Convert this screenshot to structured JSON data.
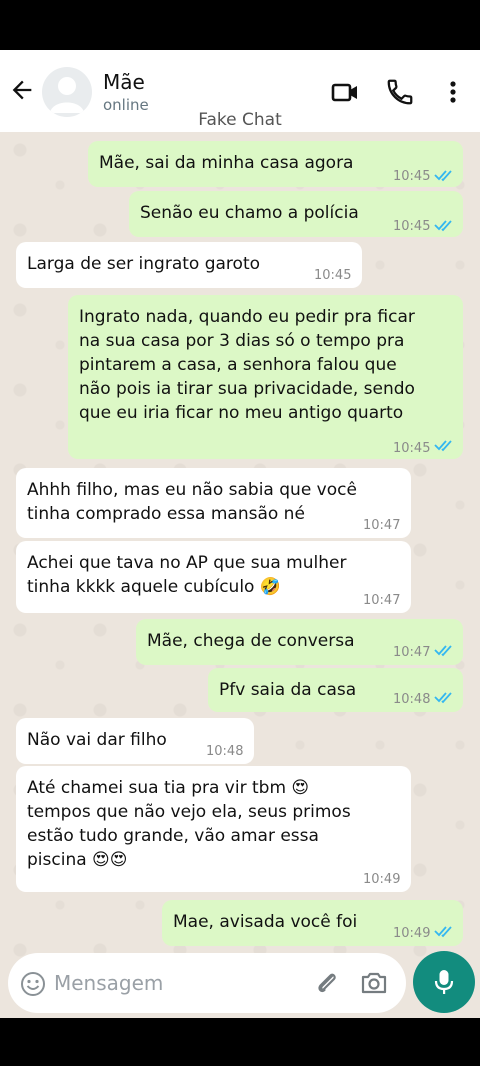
{
  "header": {
    "contact_name": "Mãe",
    "contact_status": "online",
    "watermark": "Fake Chat"
  },
  "messages": [
    {
      "direction": "out",
      "lines": "Mãe, sai da minha casa agora",
      "time": "10:45",
      "read": true
    },
    {
      "direction": "out",
      "lines": "Senão eu chamo a polícia",
      "time": "10:45",
      "read": true
    },
    {
      "direction": "in",
      "lines": "Larga de ser ingrato garoto",
      "time": "10:45"
    },
    {
      "direction": "out",
      "lines": "Ingrato nada, quando eu pedir pra ficar\nna sua casa por 3 dias só o tempo pra\npintarem a casa, a senhora falou que\nnão pois ia tirar sua privacidade, sendo\nque eu iria ficar no meu antigo quarto",
      "time": "10:45",
      "read": true
    },
    {
      "direction": "in",
      "lines": "Ahhh filho, mas eu não sabia que você\ntinha comprado essa mansão né",
      "time": "10:47"
    },
    {
      "direction": "in",
      "lines": "Achei que tava no AP que sua mulher\ntinha kkkk aquele cubículo 🤣",
      "time": "10:47"
    },
    {
      "direction": "out",
      "lines": "Mãe, chega de conversa",
      "time": "10:47",
      "read": true
    },
    {
      "direction": "out",
      "lines": "Pfv saia da casa",
      "time": "10:48",
      "read": true
    },
    {
      "direction": "in",
      "lines": "Não vai dar filho",
      "time": "10:48"
    },
    {
      "direction": "in",
      "lines": "Até chamei sua tia pra vir tbm 😍\ntempos que não vejo ela, seus primos\nestão tudo grande, vão amar essa\npiscina 😍😍",
      "time": "10:49"
    },
    {
      "direction": "out",
      "lines": "Mae, avisada você foi",
      "time": "10:49",
      "read": true
    }
  ],
  "composer": {
    "placeholder": "Mensagem"
  },
  "colors": {
    "outgoing_bubble": "#dcf8c6",
    "incoming_bubble": "#ffffff",
    "accent": "#128c7e",
    "read_ticks": "#34b7f1"
  },
  "icons": [
    "back-arrow-icon",
    "avatar-icon",
    "video-call-icon",
    "phone-icon",
    "more-vert-icon",
    "emoji-icon",
    "attach-icon",
    "camera-icon",
    "mic-icon",
    "double-check-icon"
  ]
}
